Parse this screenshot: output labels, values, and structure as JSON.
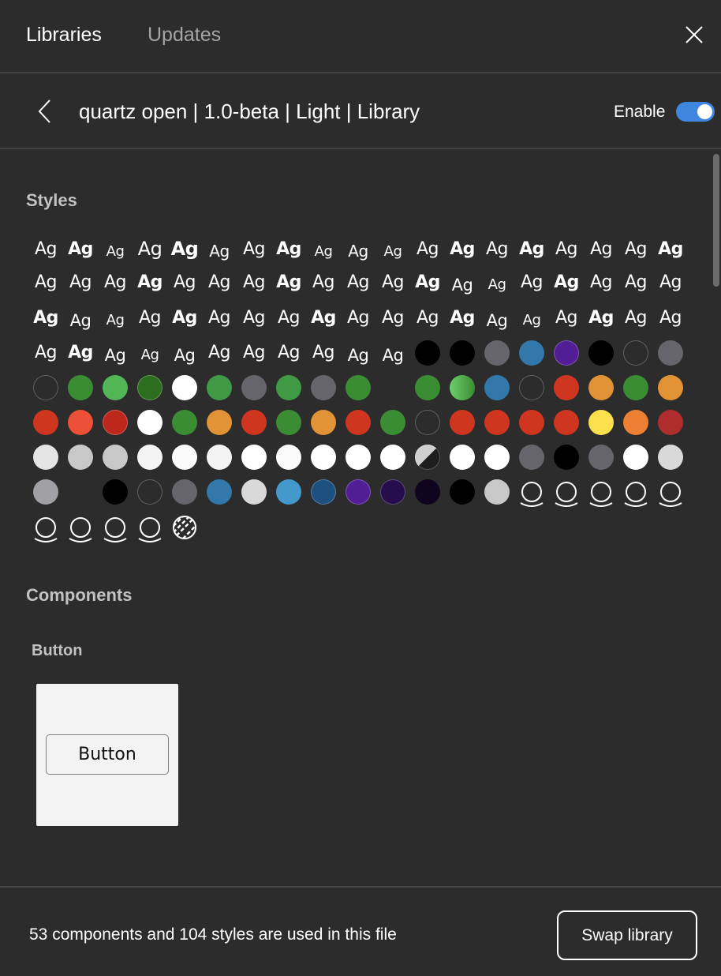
{
  "tabs": [
    {
      "label": "Libraries",
      "active": true
    },
    {
      "label": "Updates",
      "active": false
    }
  ],
  "icons": {
    "close": "close-icon",
    "back": "chevron-left-icon",
    "effect": "effect-shadow-icon",
    "pattern": "hatched-pattern-icon"
  },
  "library": {
    "title": "quartz open | 1.0-beta | Light | Library",
    "enable_label": "Enable",
    "enabled": true,
    "accent": "#3e86e0"
  },
  "styles": {
    "title": "Styles",
    "columns": 19,
    "items": [
      {
        "t": "text",
        "s": "s1"
      },
      {
        "t": "text",
        "s": "s1",
        "b": true
      },
      {
        "t": "text",
        "s": "s3"
      },
      {
        "t": "text",
        "s": "s4"
      },
      {
        "t": "text",
        "s": "s4",
        "b": true
      },
      {
        "t": "text",
        "s": "s2"
      },
      {
        "t": "text",
        "s": "s1"
      },
      {
        "t": "text",
        "s": "s1",
        "b": true
      },
      {
        "t": "text",
        "s": "s3"
      },
      {
        "t": "text",
        "s": "s2"
      },
      {
        "t": "text",
        "s": "s3"
      },
      {
        "t": "text",
        "s": "s1"
      },
      {
        "t": "text",
        "s": "s1",
        "b": true
      },
      {
        "t": "text",
        "s": "s1"
      },
      {
        "t": "text",
        "s": "s1",
        "b": true
      },
      {
        "t": "text",
        "s": "s1"
      },
      {
        "t": "text",
        "s": "s1"
      },
      {
        "t": "text",
        "s": "s1"
      },
      {
        "t": "text",
        "s": "s1",
        "b": true
      },
      {
        "t": "text",
        "s": "s1"
      },
      {
        "t": "text",
        "s": "s1"
      },
      {
        "t": "text",
        "s": "s1"
      },
      {
        "t": "text",
        "s": "s1",
        "b": true
      },
      {
        "t": "text",
        "s": "s1"
      },
      {
        "t": "text",
        "s": "s1"
      },
      {
        "t": "text",
        "s": "s1"
      },
      {
        "t": "text",
        "s": "s1",
        "b": true
      },
      {
        "t": "text",
        "s": "s1"
      },
      {
        "t": "text",
        "s": "s1"
      },
      {
        "t": "text",
        "s": "s1"
      },
      {
        "t": "text",
        "s": "s1",
        "b": true
      },
      {
        "t": "text",
        "s": "s5"
      },
      {
        "t": "text",
        "s": "s3"
      },
      {
        "t": "text",
        "s": "s1"
      },
      {
        "t": "text",
        "s": "s1",
        "b": true
      },
      {
        "t": "text",
        "s": "s1"
      },
      {
        "t": "text",
        "s": "s1"
      },
      {
        "t": "text",
        "s": "s1"
      },
      {
        "t": "text",
        "s": "s1",
        "b": true
      },
      {
        "t": "text",
        "s": "s5"
      },
      {
        "t": "text",
        "s": "s3"
      },
      {
        "t": "text",
        "s": "s1"
      },
      {
        "t": "text",
        "s": "s1",
        "b": true
      },
      {
        "t": "text",
        "s": "s1"
      },
      {
        "t": "text",
        "s": "s1"
      },
      {
        "t": "text",
        "s": "s1"
      },
      {
        "t": "text",
        "s": "s1",
        "b": true
      },
      {
        "t": "text",
        "s": "s1"
      },
      {
        "t": "text",
        "s": "s1"
      },
      {
        "t": "text",
        "s": "s1"
      },
      {
        "t": "text",
        "s": "s1",
        "b": true
      },
      {
        "t": "text",
        "s": "s5"
      },
      {
        "t": "text",
        "s": "s3"
      },
      {
        "t": "text",
        "s": "s1"
      },
      {
        "t": "text",
        "s": "s1",
        "b": true
      },
      {
        "t": "text",
        "s": "s1"
      },
      {
        "t": "text",
        "s": "s1"
      },
      {
        "t": "text",
        "s": "s1"
      },
      {
        "t": "text",
        "s": "s1",
        "b": true
      },
      {
        "t": "text",
        "s": "s5"
      },
      {
        "t": "text",
        "s": "s3"
      },
      {
        "t": "text",
        "s": "s5"
      },
      {
        "t": "text",
        "s": "s1"
      },
      {
        "t": "text",
        "s": "s1"
      },
      {
        "t": "text",
        "s": "s1"
      },
      {
        "t": "text",
        "s": "s1"
      },
      {
        "t": "text",
        "s": "s5"
      },
      {
        "t": "text",
        "s": "s5"
      },
      {
        "t": "color",
        "c": "#000000"
      },
      {
        "t": "color",
        "c": "#000000"
      },
      {
        "t": "color",
        "c": "#65656b"
      },
      {
        "t": "color",
        "c": "#3278aa"
      },
      {
        "t": "color",
        "c": "#521e96",
        "o": true
      },
      {
        "t": "color",
        "c": "#000000"
      },
      {
        "t": "color",
        "c": "#2c2c2c",
        "o": true
      },
      {
        "t": "color",
        "c": "#65656b"
      },
      {
        "t": "color",
        "c": "#2c2c2c",
        "o": true
      },
      {
        "t": "color",
        "c": "#3b8d34"
      },
      {
        "t": "color",
        "c": "#52b556"
      },
      {
        "t": "color",
        "c": "#2c6e1e",
        "o": true
      },
      {
        "t": "color",
        "c": "#ffffff"
      },
      {
        "t": "color",
        "c": "#409a45"
      },
      {
        "t": "color",
        "c": "#65656b"
      },
      {
        "t": "color",
        "c": "#409a45"
      },
      {
        "t": "color",
        "c": "#65656b"
      },
      {
        "t": "color",
        "c": "#3b8d34"
      },
      {
        "t": "empty"
      },
      {
        "t": "color",
        "c": "#3b8d34"
      },
      {
        "t": "gradient",
        "c": "#6ecf6b",
        "c2": "#3b8d34"
      },
      {
        "t": "color",
        "c": "#3278aa"
      },
      {
        "t": "color",
        "c": "#2c2c2c",
        "o": true
      },
      {
        "t": "color",
        "c": "#d0351f"
      },
      {
        "t": "color",
        "c": "#e29336"
      },
      {
        "t": "color",
        "c": "#3b8d34"
      },
      {
        "t": "color",
        "c": "#e29336"
      },
      {
        "t": "color",
        "c": "#d0351f"
      },
      {
        "t": "color",
        "c": "#ec5137"
      },
      {
        "t": "color",
        "c": "#be271b",
        "o": true
      },
      {
        "t": "color",
        "c": "#ffffff"
      },
      {
        "t": "color",
        "c": "#3b8d34"
      },
      {
        "t": "color",
        "c": "#e29336"
      },
      {
        "t": "color",
        "c": "#d0351f"
      },
      {
        "t": "color",
        "c": "#3b8d34"
      },
      {
        "t": "color",
        "c": "#e29336"
      },
      {
        "t": "color",
        "c": "#d0351f"
      },
      {
        "t": "color",
        "c": "#3b8d34"
      },
      {
        "t": "color",
        "c": "#2c2c2c",
        "o": true
      },
      {
        "t": "color",
        "c": "#d0351f"
      },
      {
        "t": "color",
        "c": "#d0351f"
      },
      {
        "t": "color",
        "c": "#d0351f"
      },
      {
        "t": "color",
        "c": "#d0351f"
      },
      {
        "t": "color",
        "c": "#fbe04b"
      },
      {
        "t": "color",
        "c": "#ee8033"
      },
      {
        "t": "color",
        "c": "#af2d2d"
      },
      {
        "t": "color",
        "c": "#e4e4e4"
      },
      {
        "t": "color",
        "c": "#c8c8c8"
      },
      {
        "t": "color",
        "c": "#c8c8c8"
      },
      {
        "t": "color",
        "c": "#f3f3f3"
      },
      {
        "t": "color",
        "c": "#fafafa"
      },
      {
        "t": "color",
        "c": "#f3f3f3"
      },
      {
        "t": "color",
        "c": "#ffffff"
      },
      {
        "t": "color",
        "c": "#fafafa"
      },
      {
        "t": "color",
        "c": "#ffffff"
      },
      {
        "t": "color",
        "c": "#ffffff"
      },
      {
        "t": "color",
        "c": "#ffffff"
      },
      {
        "t": "transparent"
      },
      {
        "t": "color",
        "c": "#ffffff"
      },
      {
        "t": "color",
        "c": "#ffffff"
      },
      {
        "t": "color",
        "c": "#65656b"
      },
      {
        "t": "color",
        "c": "#000000"
      },
      {
        "t": "color",
        "c": "#65656b"
      },
      {
        "t": "color",
        "c": "#ffffff"
      },
      {
        "t": "color",
        "c": "#d9d9d9"
      },
      {
        "t": "color",
        "c": "#a0a0a5"
      },
      {
        "t": "empty"
      },
      {
        "t": "color",
        "c": "#000000"
      },
      {
        "t": "color",
        "c": "#2c2c2c",
        "o": true
      },
      {
        "t": "color",
        "c": "#65656b"
      },
      {
        "t": "color",
        "c": "#3278aa"
      },
      {
        "t": "color",
        "c": "#d9d9d9"
      },
      {
        "t": "color",
        "c": "#4499cc"
      },
      {
        "t": "color",
        "c": "#1e507f",
        "o": true
      },
      {
        "t": "color",
        "c": "#521e96",
        "o": true
      },
      {
        "t": "color",
        "c": "#250e4b",
        "o": true
      },
      {
        "t": "color",
        "c": "#10051e"
      },
      {
        "t": "color",
        "c": "#000000"
      },
      {
        "t": "color",
        "c": "#c8c8c8"
      },
      {
        "t": "effect"
      },
      {
        "t": "effect"
      },
      {
        "t": "effect"
      },
      {
        "t": "effect"
      },
      {
        "t": "effect"
      },
      {
        "t": "effect"
      },
      {
        "t": "effect"
      },
      {
        "t": "effect"
      },
      {
        "t": "effect"
      },
      {
        "t": "pattern"
      }
    ]
  },
  "sample_text": "Ag",
  "components": {
    "title": "Components",
    "groups": [
      {
        "title": "Button",
        "items": [
          {
            "preview_label": "Button"
          }
        ]
      }
    ]
  },
  "footer": {
    "summary": "53 components and 104 styles are used in this file",
    "swap_label": "Swap library"
  }
}
